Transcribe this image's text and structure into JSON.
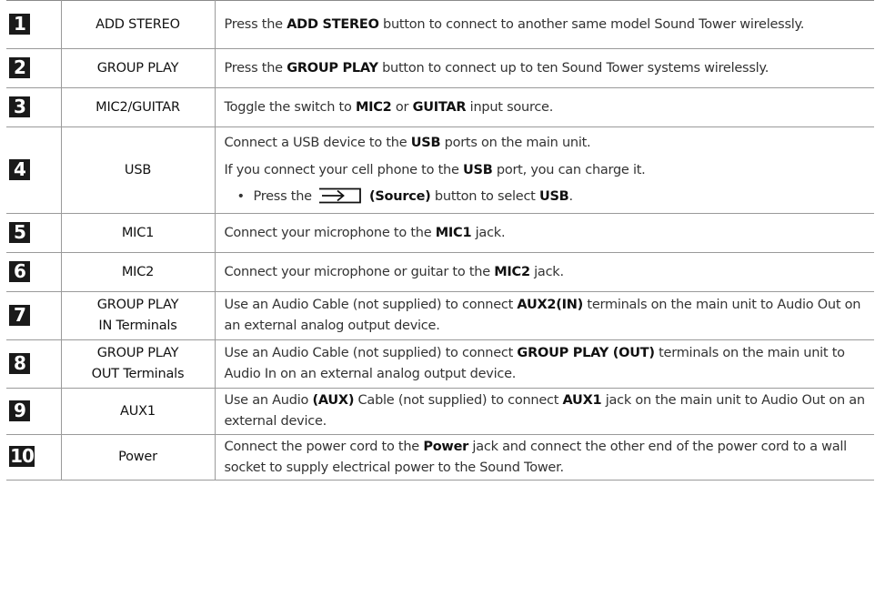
{
  "rows": [
    {
      "number": "1",
      "label": "ADD STEREO",
      "lines": [
        [
          {
            "t": "Press the ",
            "b": false
          },
          {
            "t": "ADD STEREO",
            "b": true
          },
          {
            "t": " button to connect to another same model Sound Tower wirelessly.",
            "b": false
          }
        ]
      ]
    },
    {
      "number": "2",
      "label": "GROUP PLAY",
      "lines": [
        [
          {
            "t": "Press the ",
            "b": false
          },
          {
            "t": "GROUP PLAY",
            "b": true
          },
          {
            "t": " button to connect up to ten Sound Tower systems wirelessly.",
            "b": false
          }
        ]
      ]
    },
    {
      "number": "3",
      "label": "MIC2/GUITAR",
      "lines": [
        [
          {
            "t": "Toggle the switch to ",
            "b": false
          },
          {
            "t": "MIC2",
            "b": true
          },
          {
            "t": " or ",
            "b": false
          },
          {
            "t": "GUITAR",
            "b": true
          },
          {
            "t": " input source.",
            "b": false
          }
        ]
      ]
    },
    {
      "number": "4",
      "label": "USB",
      "lines": [
        [
          {
            "t": "Connect a USB device to the ",
            "b": false
          },
          {
            "t": "USB",
            "b": true
          },
          {
            "t": " ports on the main unit.",
            "b": false
          }
        ],
        [
          {
            "t": "If you connect your cell phone to the ",
            "b": false
          },
          {
            "t": "USB",
            "b": true
          },
          {
            "t": " port, you can charge it.",
            "b": false
          }
        ]
      ],
      "bullet": {
        "symbol": "•",
        "icon": "source-icon",
        "parts": [
          {
            "t": "Press the ",
            "b": false
          },
          {
            "icon": true
          },
          {
            "t": " (Source)",
            "b": true
          },
          {
            "t": " button to select ",
            "b": false
          },
          {
            "t": "USB",
            "b": true
          },
          {
            "t": ".",
            "b": false
          }
        ]
      }
    },
    {
      "number": "5",
      "label": "MIC1",
      "lines": [
        [
          {
            "t": "Connect your microphone to the ",
            "b": false
          },
          {
            "t": "MIC1",
            "b": true
          },
          {
            "t": " jack.",
            "b": false
          }
        ]
      ]
    },
    {
      "number": "6",
      "label": "MIC2",
      "lines": [
        [
          {
            "t": "Connect your microphone or guitar to the ",
            "b": false
          },
          {
            "t": "MIC2",
            "b": true
          },
          {
            "t": " jack.",
            "b": false
          }
        ]
      ]
    },
    {
      "number": "7",
      "label_lines": [
        "GROUP PLAY",
        "IN Terminals"
      ],
      "lines": [
        [
          {
            "t": "Use an Audio Cable (not supplied) to connect ",
            "b": false
          },
          {
            "t": "AUX2(IN)",
            "b": true
          },
          {
            "t": " terminals on the main unit to Audio Out on an external analog output device.",
            "b": false
          }
        ]
      ]
    },
    {
      "number": "8",
      "label_lines": [
        "GROUP PLAY",
        "OUT Terminals"
      ],
      "lines": [
        [
          {
            "t": "Use an Audio Cable (not supplied) to connect ",
            "b": false
          },
          {
            "t": "GROUP PLAY (OUT)",
            "b": true
          },
          {
            "t": " terminals on the main unit to Audio In on an external analog output device.",
            "b": false
          }
        ]
      ]
    },
    {
      "number": "9",
      "label": "AUX1",
      "lines": [
        [
          {
            "t": "Use an Audio ",
            "b": false
          },
          {
            "t": "(AUX)",
            "b": true
          },
          {
            "t": " Cable (not supplied) to connect ",
            "b": false
          },
          {
            "t": "AUX1",
            "b": true
          },
          {
            "t": " jack on the main unit to Audio Out on an external device.",
            "b": false
          }
        ]
      ]
    },
    {
      "number": "10",
      "label": "Power",
      "lines": [
        [
          {
            "t": "Connect the power cord to the ",
            "b": false
          },
          {
            "t": "Power",
            "b": true
          },
          {
            "t": " jack and connect the other end of the power cord to a wall socket to supply electrical power to the Sound Tower.",
            "b": false
          }
        ]
      ]
    }
  ]
}
